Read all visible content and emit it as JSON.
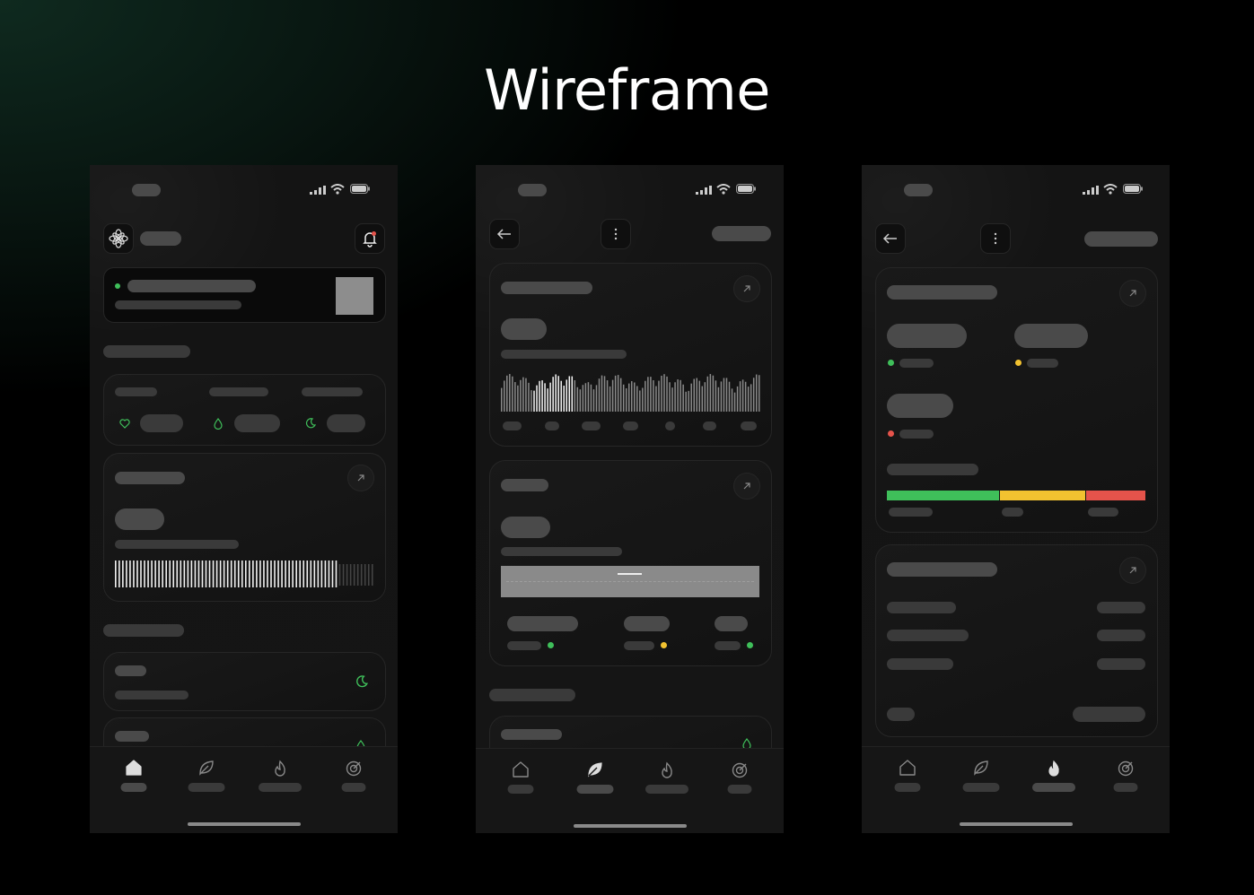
{
  "page": {
    "title": "Wireframe"
  },
  "colors": {
    "accent_green": "#3fbf5a",
    "accent_yellow": "#f2c230",
    "accent_red": "#e5534b",
    "placeholder": "#3a3a3a",
    "card_bg": "#171717"
  },
  "icons": {
    "status": [
      "signal-icon",
      "wifi-icon",
      "battery-icon"
    ],
    "screen1_header": [
      "flower-logo-icon",
      "bell-icon"
    ],
    "screen1_metrics": [
      "heart-icon",
      "droplet-icon",
      "moon-icon"
    ],
    "screen2_header": [
      "back-arrow-icon",
      "more-vertical-icon"
    ],
    "screen3_header": [
      "back-arrow-icon",
      "more-vertical-icon"
    ],
    "nav": [
      "home-icon",
      "leaf-icon",
      "flame-icon",
      "target-icon"
    ]
  },
  "screens": [
    {
      "name": "home",
      "active_tab": "home"
    },
    {
      "name": "leaf-detail",
      "active_tab": "leaf"
    },
    {
      "name": "flame-detail",
      "active_tab": "flame"
    }
  ],
  "progress": {
    "bar_fill_fraction": 0.85
  },
  "legend_colors": [
    "green",
    "yellow",
    "red"
  ],
  "range_bar": {
    "segments": [
      0.47,
      0.37,
      0.25
    ]
  }
}
